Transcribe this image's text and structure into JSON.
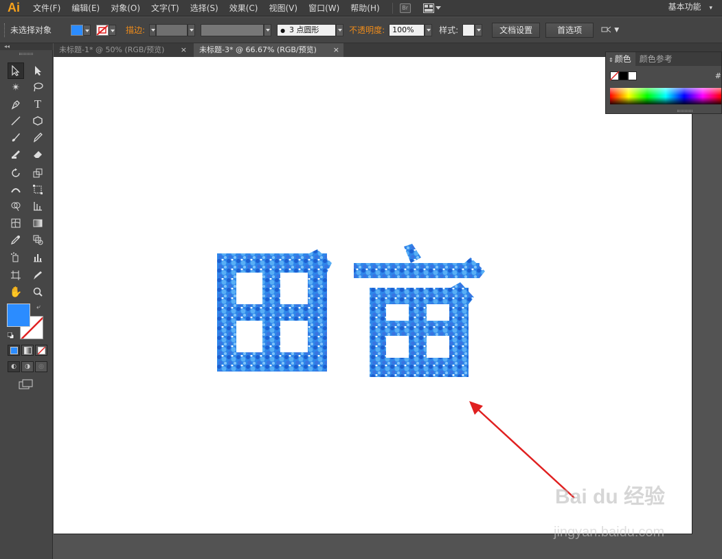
{
  "app": {
    "logo": "Ai"
  },
  "menubar": {
    "items": [
      "文件(F)",
      "编辑(E)",
      "对象(O)",
      "文字(T)",
      "选择(S)",
      "效果(C)",
      "视图(V)",
      "窗口(W)",
      "帮助(H)"
    ],
    "bridge_label": "Br",
    "workspace": "基本功能"
  },
  "control_bar": {
    "selection_status": "未选择对象",
    "fill_color": "#2b8cff",
    "stroke_label": "描边:",
    "brush_label": "3 点圆形",
    "opacity_label": "不透明度:",
    "opacity_value": "100%",
    "style_label": "样式:",
    "doc_setup_button": "文档设置",
    "preferences_button": "首选项"
  },
  "tabs": [
    {
      "label": "未标题-1* @ 50% (RGB/预览)",
      "active": false
    },
    {
      "label": "未标题-3* @ 66.67% (RGB/预览)",
      "active": true
    }
  ],
  "color_panel": {
    "tab_color": "颜色",
    "tab_guide": "颜色参考",
    "hash": "#"
  },
  "artwork": {
    "text": "田亩",
    "fill_color": "#2b7fe6",
    "arrow_color": "#e02020"
  },
  "watermark": {
    "brand": "Bai du 经验",
    "url": "jingyan.baidu.com"
  }
}
